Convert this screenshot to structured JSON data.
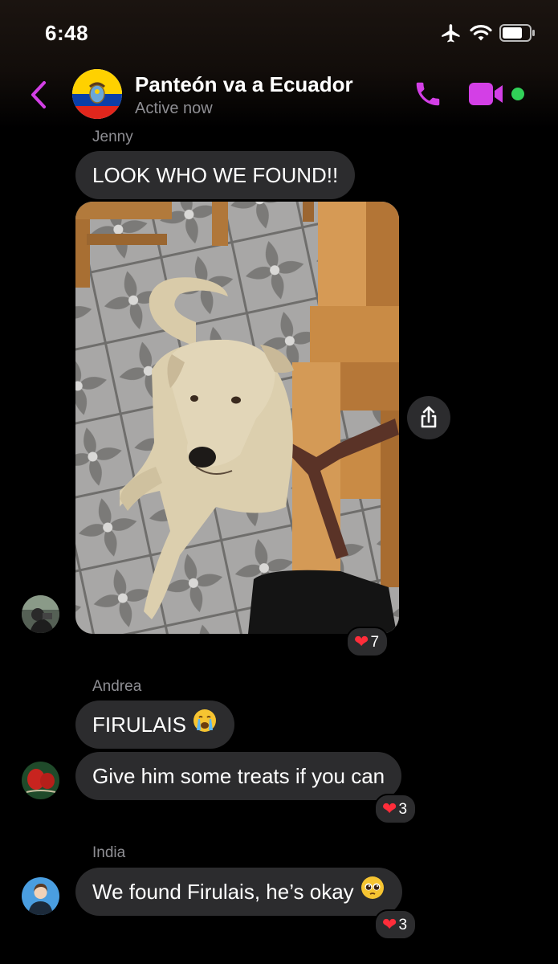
{
  "status_bar": {
    "time": "6:48"
  },
  "header": {
    "title": "Panteón va a Ecuador",
    "subtitle": "Active now"
  },
  "messages": [
    {
      "sender": "Jenny",
      "text": "LOOK WHO WE FOUND!!",
      "photo_reactions": "7"
    },
    {
      "sender": "Andrea",
      "text": "FIRULAIS",
      "emoji": "crying-face"
    },
    {
      "text": "Give him some treats if you can",
      "reactions": "3"
    },
    {
      "sender": "India",
      "text": "We found Firulais, he’s okay",
      "emoji": "pleading-face",
      "reactions": "3"
    }
  ],
  "colors": {
    "accent": "#d33fe6",
    "bubble": "#2c2c2e",
    "online": "#31d158",
    "heart": "#ff2d3a"
  },
  "icons": [
    "back-chevron-icon",
    "phone-icon",
    "video-camera-icon",
    "share-icon",
    "airplane-icon",
    "wifi-icon",
    "battery-icon"
  ]
}
